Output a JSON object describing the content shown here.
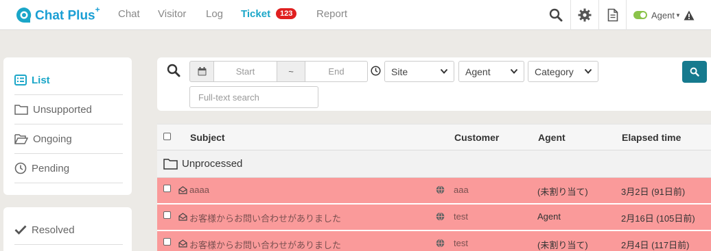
{
  "app": {
    "logo_text": "Chat Plus",
    "logo_sup": "+",
    "nav": [
      {
        "label": "Chat"
      },
      {
        "label": "Visitor"
      },
      {
        "label": "Log"
      },
      {
        "label": "Ticket",
        "badge": "123"
      },
      {
        "label": "Report"
      }
    ],
    "tools": [
      "search-icon",
      "gear-icon",
      "document-icon"
    ],
    "agent": {
      "label": "Agent",
      "status_color": "#8bc34a"
    }
  },
  "sidebar": {
    "items": [
      {
        "label": "List",
        "icon": "list-icon",
        "active": true
      },
      {
        "label": "Unsupported",
        "icon": "folder-icon"
      },
      {
        "label": "Ongoing",
        "icon": "folder-open-icon"
      },
      {
        "label": "Pending",
        "icon": "clock-icon"
      }
    ],
    "items2": [
      {
        "label": "Resolved",
        "icon": "check-icon"
      }
    ]
  },
  "search": {
    "start_placeholder": "Start",
    "range_sep": "~",
    "end_placeholder": "End",
    "site": "Site",
    "agent": "Agent",
    "category": "Category",
    "fulltext_placeholder": "Full-text search"
  },
  "table": {
    "headers": {
      "subject": "Subject",
      "customer": "Customer",
      "agent": "Agent",
      "elapsed": "Elapsed time"
    },
    "group": "Unprocessed",
    "rows": [
      {
        "subject": "aaaa",
        "customer": "aaa",
        "agent": "(未割り当て)",
        "elapsed": "3月2日 (91日前)"
      },
      {
        "subject": "お客様からお問い合わせがありました",
        "customer": "test",
        "agent": "Agent",
        "elapsed": "2月16日 (105日前)"
      },
      {
        "subject": "お客様からお問い合わせがありました",
        "customer": "test",
        "agent": "(未割り当て)",
        "elapsed": "2月4日 (117日前)"
      }
    ]
  },
  "colors": {
    "accent": "#1aa6c8",
    "badge": "#e02020",
    "row_highlight": "#fa9a9a",
    "search_button": "#167a8e"
  }
}
